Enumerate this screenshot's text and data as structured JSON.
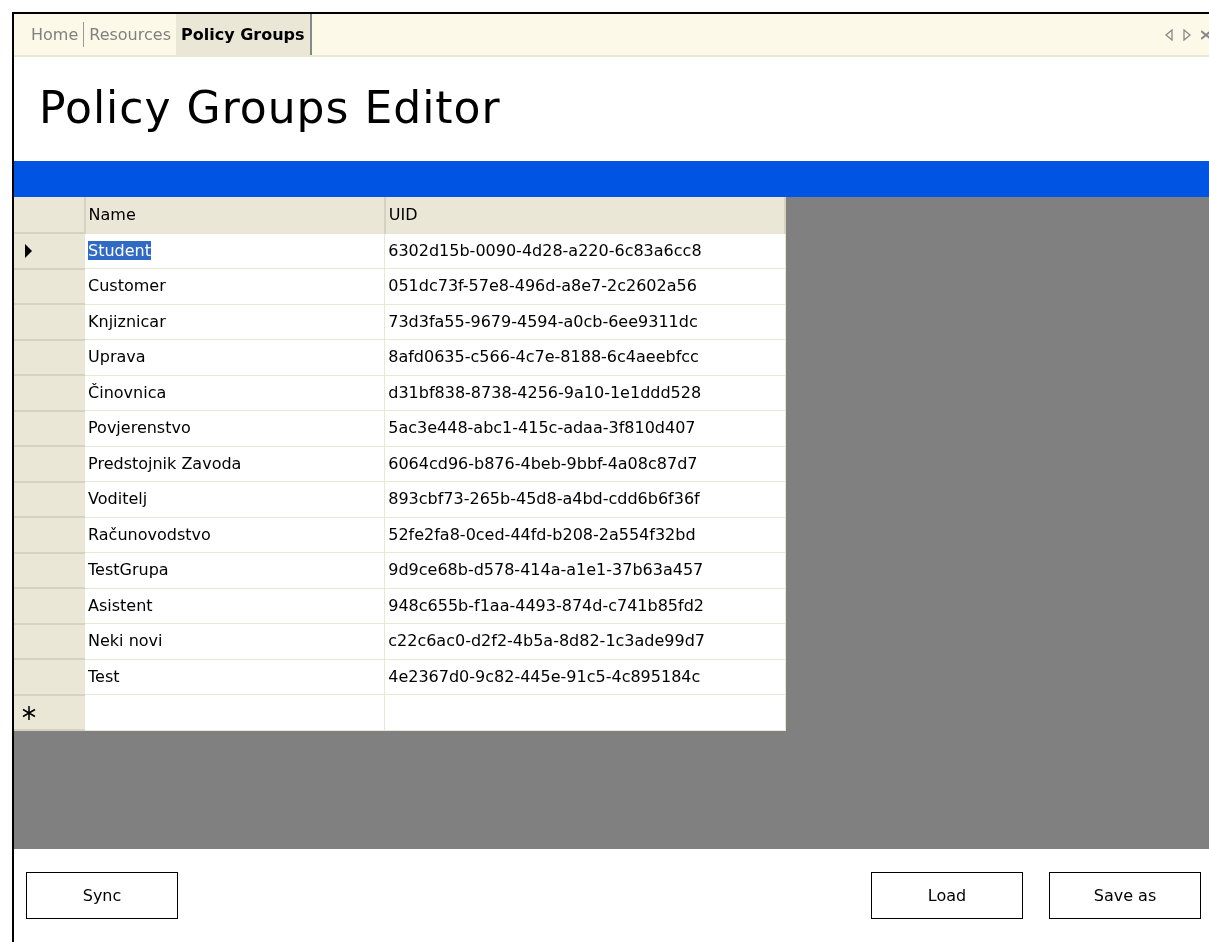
{
  "tabs": [
    {
      "label": "Home",
      "selected": false
    },
    {
      "label": "Resources",
      "selected": false
    },
    {
      "label": "Policy Groups",
      "selected": true
    }
  ],
  "title": "Policy Groups Editor",
  "table": {
    "columns": [
      "Name",
      "UID"
    ],
    "rows": [
      {
        "name": "Student",
        "uid": "6302d15b-0090-4d28-a220-6c83a6cc8",
        "selected": true
      },
      {
        "name": "Customer",
        "uid": "051dc73f-57e8-496d-a8e7-2c2602a56",
        "selected": false
      },
      {
        "name": "Knjiznicar",
        "uid": "73d3fa55-9679-4594-a0cb-6ee9311dc",
        "selected": false
      },
      {
        "name": "Uprava",
        "uid": "8afd0635-c566-4c7e-8188-6c4aeebfcc",
        "selected": false
      },
      {
        "name": "Činovnica",
        "uid": "d31bf838-8738-4256-9a10-1e1ddd528",
        "selected": false
      },
      {
        "name": "Povjerenstvo",
        "uid": "5ac3e448-abc1-415c-adaa-3f810d407",
        "selected": false
      },
      {
        "name": "Predstojnik Zavoda",
        "uid": "6064cd96-b876-4beb-9bbf-4a08c87d7",
        "selected": false
      },
      {
        "name": "Voditelj",
        "uid": "893cbf73-265b-45d8-a4bd-cdd6b6f36f",
        "selected": false
      },
      {
        "name": "Računovodstvo",
        "uid": "52fe2fa8-0ced-44fd-b208-2a554f32bd",
        "selected": false
      },
      {
        "name": "TestGrupa",
        "uid": "9d9ce68b-d578-414a-a1e1-37b63a457",
        "selected": false
      },
      {
        "name": "Asistent",
        "uid": "948c655b-f1aa-4493-874d-c741b85fd2",
        "selected": false
      },
      {
        "name": "Neki novi",
        "uid": "c22c6ac0-d2f2-4b5a-8d82-1c3ade99d7",
        "selected": false
      },
      {
        "name": "Test",
        "uid": "4e2367d0-9c82-445e-91c5-4c895184c",
        "selected": false
      }
    ],
    "new_row": true
  },
  "buttons_left": [
    "Sync"
  ],
  "buttons_right": [
    "Load",
    "Save as"
  ]
}
